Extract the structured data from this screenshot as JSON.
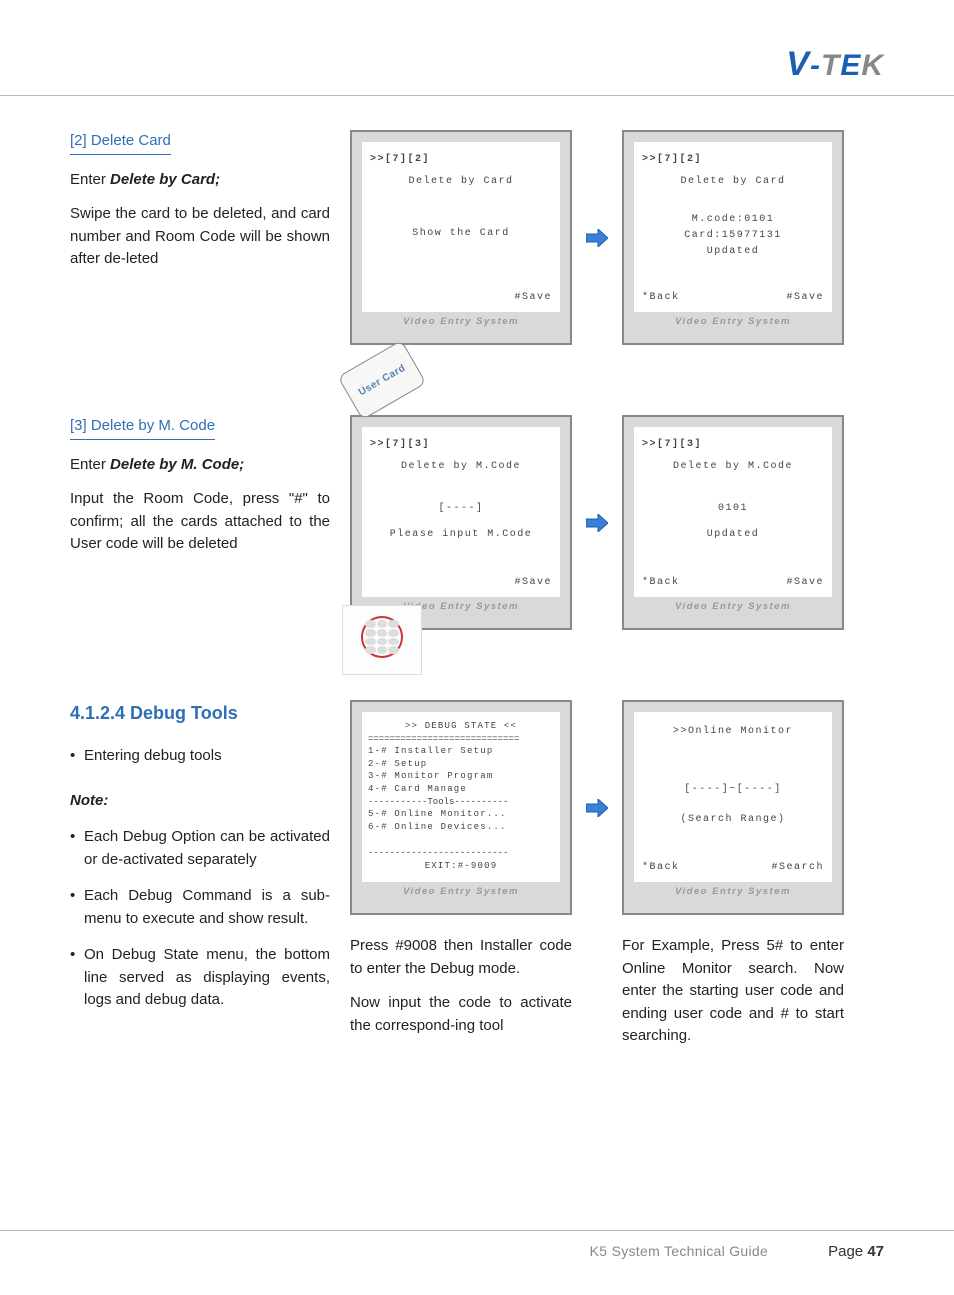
{
  "logo": {
    "v": "V",
    "dash": "-",
    "t": "T",
    "e": "E",
    "k": "K"
  },
  "section2": {
    "heading": "[2] Delete Card",
    "enter_prefix": "Enter ",
    "enter_bold": "Delete by Card;",
    "body": "Swipe the card to be deleted, and card number and Room Code will be shown after de-leted"
  },
  "section3": {
    "heading": "[3] Delete by M. Code",
    "enter_prefix": "Enter ",
    "enter_bold": "Delete by M. Code;",
    "body": "Input the Room Code, press \"#\" to confirm; all the cards attached to the User code will be deleted"
  },
  "section4": {
    "heading": "4.1.2.4 Debug Tools",
    "bullet1": "Entering debug tools",
    "note_label": "Note:",
    "notes": [
      "Each Debug Option can be activated or de-activated separately",
      "Each Debug Command is a sub-menu to execute and show result.",
      "On Debug State menu, the bottom line served as displaying events, logs and debug data."
    ],
    "below_left": "Press #9008 then Installer code to enter the Debug mode.",
    "below_left2": "Now input the code to activate the correspond-ing tool",
    "below_right": "For Example, Press 5# to enter Online Monitor search. Now enter the starting user code and ending user code and # to start searching."
  },
  "screens": {
    "footer": "Video Entry System",
    "s2a": {
      "top": ">>[7][2]",
      "title": "Delete by Card",
      "mid": "Show the Card",
      "save": "#Save"
    },
    "s2b": {
      "top": ">>[7][2]",
      "title": "Delete by Card",
      "l1": "M.code:0101",
      "l2": "Card:15977131",
      "l3": "Updated",
      "back": "*Back",
      "save": "#Save"
    },
    "s3a": {
      "top": ">>[7][3]",
      "title": "Delete by M.Code",
      "mid1": "[----]",
      "mid2": "Please input M.Code",
      "save": "#Save"
    },
    "s3b": {
      "top": ">>[7][3]",
      "title": "Delete by M.Code",
      "mid1": "0101",
      "mid2": "Updated",
      "back": "*Back",
      "save": "#Save"
    },
    "s4a": {
      "title": ">> DEBUG STATE <<",
      "m1": "1-# Installer Setup",
      "m2": "2-# Setup",
      "m3": "3-# Monitor Program",
      "m4": "4-# Card Manage",
      "tools": "-----------Tools----------",
      "m5": "5-# Online Monitor...",
      "m6": "6-# Online Devices...",
      "dashes": "--------------------------",
      "exit": "EXIT:#-9009"
    },
    "s4b": {
      "title": ">>Online Monitor",
      "mid1": "[----]~[----]",
      "mid2": "(Search Range)",
      "back": "*Back",
      "search": "#Search"
    }
  },
  "user_card_label": "User Card",
  "footer": {
    "guide": "K5 System Technical Guide",
    "page": "Page ",
    "num": "47"
  }
}
